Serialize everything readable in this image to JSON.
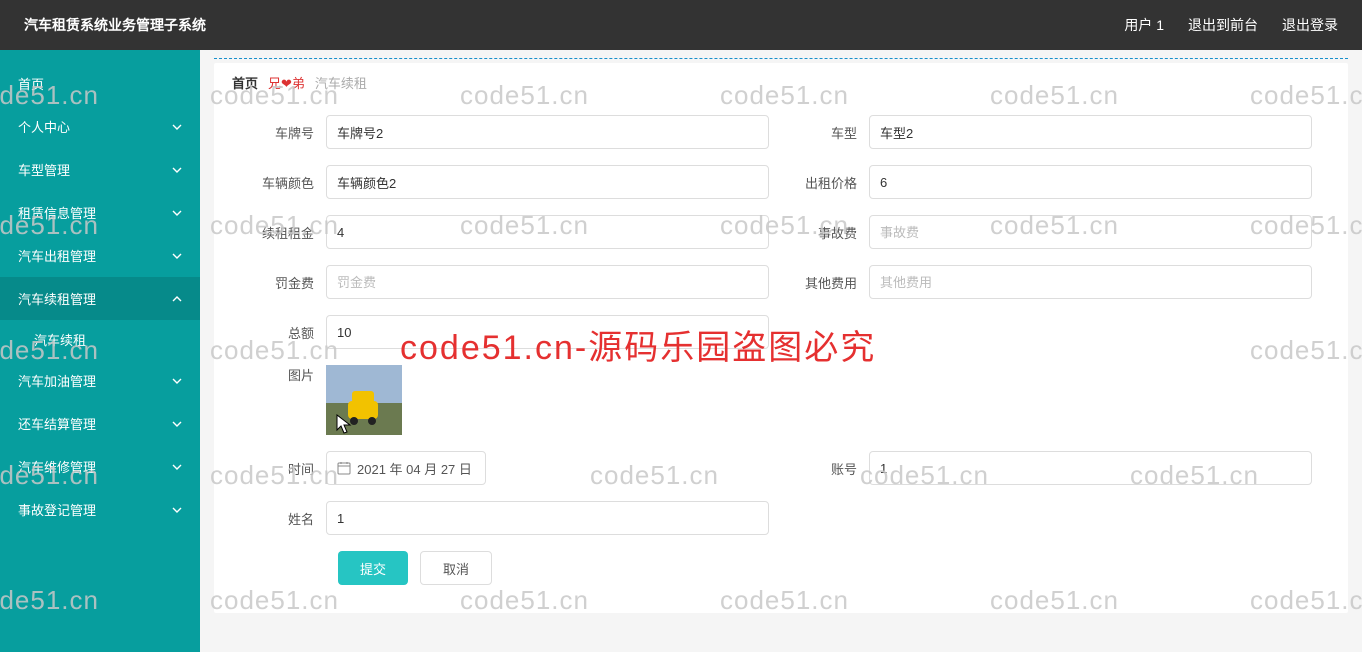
{
  "header": {
    "title": "汽车租赁系统业务管理子系统",
    "user": "用户 1",
    "back_to_front": "退出到前台",
    "logout": "退出登录"
  },
  "sidebar": {
    "items": [
      {
        "label": "首页",
        "has_children": false
      },
      {
        "label": "个人中心",
        "has_children": true
      },
      {
        "label": "车型管理",
        "has_children": true
      },
      {
        "label": "租赁信息管理",
        "has_children": true
      },
      {
        "label": "汽车出租管理",
        "has_children": true
      },
      {
        "label": "汽车续租管理",
        "has_children": true,
        "expanded": true,
        "children": [
          {
            "label": "汽车续租"
          }
        ]
      },
      {
        "label": "汽车加油管理",
        "has_children": true
      },
      {
        "label": "还车结算管理",
        "has_children": true
      },
      {
        "label": "汽车维修管理",
        "has_children": true
      },
      {
        "label": "事故登记管理",
        "has_children": true
      }
    ]
  },
  "tabs": {
    "home": "首页",
    "aux": "兄❤弟",
    "current": "汽车续租"
  },
  "form": {
    "plate": {
      "label": "车牌号",
      "value": "车牌号2"
    },
    "model": {
      "label": "车型",
      "value": "车型2"
    },
    "color": {
      "label": "车辆颜色",
      "value": "车辆颜色2"
    },
    "rental_price": {
      "label": "出租价格",
      "value": "6"
    },
    "renew_fee": {
      "label": "续租租金",
      "value": "4"
    },
    "accident_fee": {
      "label": "事故费",
      "value": "",
      "placeholder": "事故费"
    },
    "penalty": {
      "label": "罚金费",
      "value": "",
      "placeholder": "罚金费"
    },
    "other_fee": {
      "label": "其他费用",
      "value": "",
      "placeholder": "其他费用"
    },
    "total": {
      "label": "总额",
      "value": "10"
    },
    "image": {
      "label": "图片"
    },
    "time": {
      "label": "时间",
      "value": "2021 年 04 月 27 日"
    },
    "account": {
      "label": "账号",
      "value": "1"
    },
    "name": {
      "label": "姓名",
      "value": "1"
    }
  },
  "buttons": {
    "submit": "提交",
    "cancel": "取消"
  },
  "watermark": {
    "text": "code51.cn",
    "center": "code51.cn-源码乐园盗图必究"
  }
}
